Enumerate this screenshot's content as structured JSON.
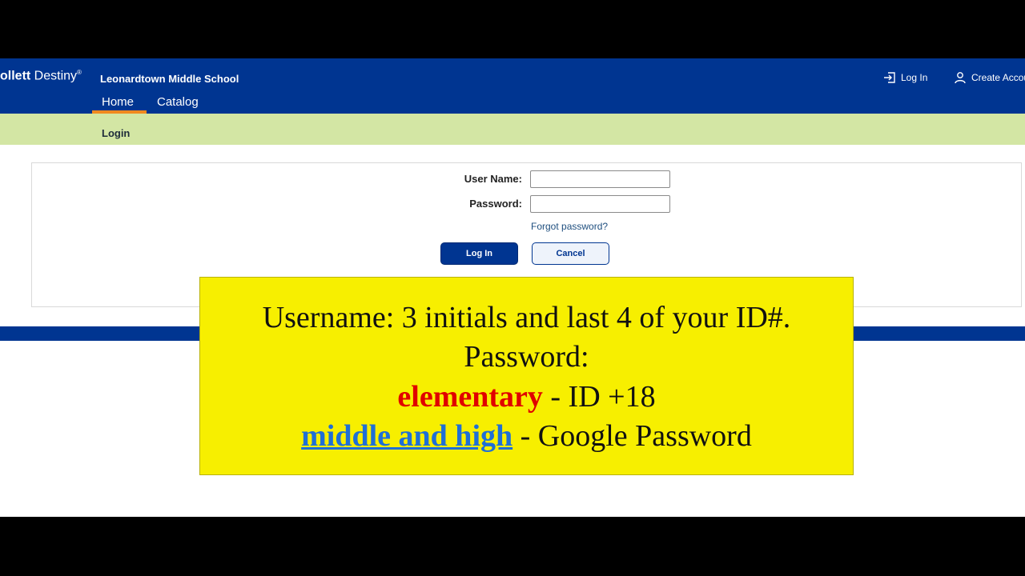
{
  "header": {
    "brand_bold": "ollett",
    "brand_light": "Destiny",
    "brand_mark": "®",
    "school_name": "Leonardtown Middle School",
    "login_link": "Log In",
    "create_account_link": "Create Accou"
  },
  "nav": {
    "tabs": [
      {
        "label": "Home",
        "active": true
      },
      {
        "label": "Catalog",
        "active": false
      }
    ],
    "active_underline_color": "#f08a1f"
  },
  "subnav": {
    "label": "Login"
  },
  "login_form": {
    "username_label": "User Name:",
    "username_value": "",
    "password_label": "Password:",
    "password_value": "",
    "forgot_link": "Forgot password?",
    "login_button": "Log In",
    "cancel_button": "Cancel"
  },
  "callout": {
    "line1": "Username: 3 initials and last 4 of your ID#.",
    "line2": "Password:",
    "line3_highlight": "elementary",
    "line3_rest": " - ID +18",
    "line4_highlight": "middle and high",
    "line4_rest": " - Google Password",
    "background_color": "#f7ef00",
    "highlight_red": "#e00000",
    "highlight_blue": "#1f6fd6"
  },
  "colors": {
    "brand_blue": "#003591",
    "subbar_green": "#d3e6a4"
  }
}
